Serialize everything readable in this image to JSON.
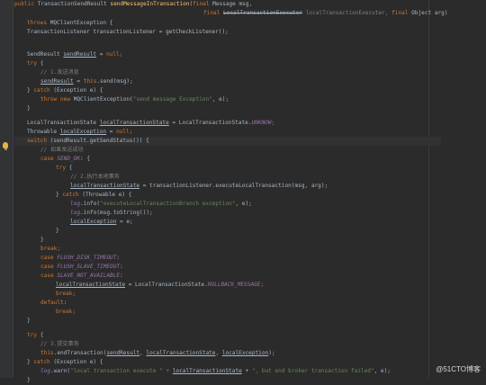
{
  "colors": {
    "background": "#2b2b2b",
    "keyword": "#cc7832",
    "method_name": "#ffc66d",
    "string": "#6a8759",
    "comment": "#808080",
    "constant": "#9876aa",
    "plain": "#a9b7c6"
  },
  "gutter_icon": "lightbulb-icon",
  "watermark": "@51CTO博客",
  "code": {
    "l0": {
      "a": "public ",
      "b": "TransactionSendResult ",
      "c": "sendMessageInTransaction",
      "d": "(",
      "e": "final ",
      "f": "Message msg,"
    },
    "l1": {
      "a": "final ",
      "b": "LocalTransactionExecuter",
      "c": " localTransactionExecuter, ",
      "d": "final ",
      "e": "Object arg)"
    },
    "l2": {
      "a": "throws ",
      "b": "MQClientException {"
    },
    "l3": {
      "a": "TransactionListener transactionListener = getCheckListener();"
    },
    "l4": {
      "a": "SendResult ",
      "b": "sendResult",
      "c": " = ",
      "d": "null",
      "e": ";"
    },
    "l5": {
      "a": "try ",
      "b": "{"
    },
    "l6": {
      "a": "// 1.发送消息"
    },
    "l7": {
      "a": "sendResult",
      "b": " = ",
      "c": "this",
      "d": ".send(msg);"
    },
    "l8": {
      "a": "} ",
      "b": "catch ",
      "c": "(Exception e) {"
    },
    "l9": {
      "a": "throw new ",
      "b": "MQClientException(",
      "c": "\"send message Exception\"",
      "d": ", e);"
    },
    "l10": {
      "a": "}"
    },
    "l11": {
      "a": "LocalTransactionState ",
      "b": "localTransactionState",
      "c": " = LocalTransactionState.",
      "d": "UNKNOW",
      "e": ";"
    },
    "l12": {
      "a": "Throwable ",
      "b": "localException",
      "c": " = ",
      "d": "null",
      "e": ";"
    },
    "l13": {
      "a": "switch ",
      "b": "(sendResult.getSendStatus()) {"
    },
    "l14": {
      "a": "// 如果发送成功"
    },
    "l15": {
      "a": "case ",
      "b": "SEND_OK",
      "c": ": {"
    },
    "l16": {
      "a": "try ",
      "b": "{"
    },
    "l17": {
      "a": "// 2.执行本地事务"
    },
    "l18": {
      "a": "localTransactionState",
      "b": " = transactionListener.executeLocalTransaction(msg, arg);"
    },
    "l19": {
      "a": "} ",
      "b": "catch ",
      "c": "(Throwable e) {"
    },
    "l20": {
      "a": "log",
      "b": ".info(",
      "c": "\"executeLocalTransactionBranch exception\"",
      "d": ", e);"
    },
    "l21": {
      "a": "log",
      "b": ".info(msg.toString());"
    },
    "l22": {
      "a": "localException",
      "b": " = e;"
    },
    "l23": {
      "a": "}"
    },
    "l24": {
      "a": "}"
    },
    "l25": {
      "a": "break",
      "b": ";"
    },
    "l26": {
      "a": "case ",
      "b": "FLUSH_DISK_TIMEOUT",
      "c": ":"
    },
    "l27": {
      "a": "case ",
      "b": "FLUSH_SLAVE_TIMEOUT",
      "c": ":"
    },
    "l28": {
      "a": "case ",
      "b": "SLAVE_NOT_AVAILABLE",
      "c": ":"
    },
    "l29": {
      "a": "localTransactionState",
      "b": " = LocalTransactionState.",
      "c": "ROLLBACK_MESSAGE",
      "d": ";"
    },
    "l30": {
      "a": "break",
      "b": ";"
    },
    "l31": {
      "a": "default",
      "b": ":"
    },
    "l32": {
      "a": "break",
      "b": ";"
    },
    "l33": {
      "a": "}"
    },
    "l34": {
      "a": "try ",
      "b": "{"
    },
    "l35": {
      "a": "// 3.提交事务"
    },
    "l36": {
      "a": "this",
      "b": ".endTransaction(",
      "c": "sendResult",
      "d": ", ",
      "e": "localTransactionState",
      "f": ", ",
      "g": "localException",
      "h": ");"
    },
    "l37": {
      "a": "} ",
      "b": "catch ",
      "c": "(Exception e) {"
    },
    "l38": {
      "a": "log",
      "b": ".warn(",
      "c": "\"local transaction execute \" + ",
      "d": "localTransactionState",
      "e": " + ",
      "f": "\", but end broker transaction failed\"",
      "g": ", e);"
    },
    "l39": {
      "a": "}"
    }
  }
}
